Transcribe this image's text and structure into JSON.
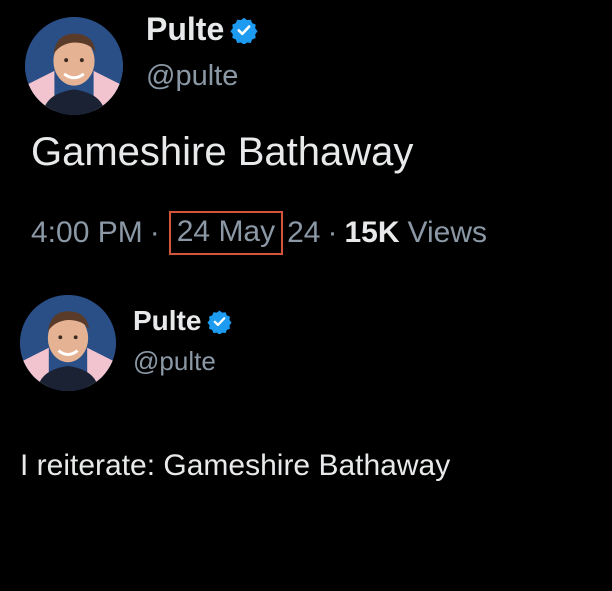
{
  "tweet1": {
    "author": {
      "name": "Pulte",
      "handle": "@pulte",
      "verified_icon": "verified-badge-icon",
      "badge_color": "#1d9bf0"
    },
    "text": "Gameshire Bathaway",
    "meta": {
      "time": "4:00 PM",
      "separator": "·",
      "date_part": "24 May",
      "year_part": "24",
      "views_count": "15K",
      "views_label": "Views"
    },
    "highlight_color": "#d2543a"
  },
  "tweet2": {
    "author": {
      "name": "Pulte",
      "handle": "@pulte",
      "verified_icon": "verified-badge-icon",
      "badge_color": "#1d9bf0"
    },
    "text": "I reiterate: Gameshire Bathaway"
  }
}
